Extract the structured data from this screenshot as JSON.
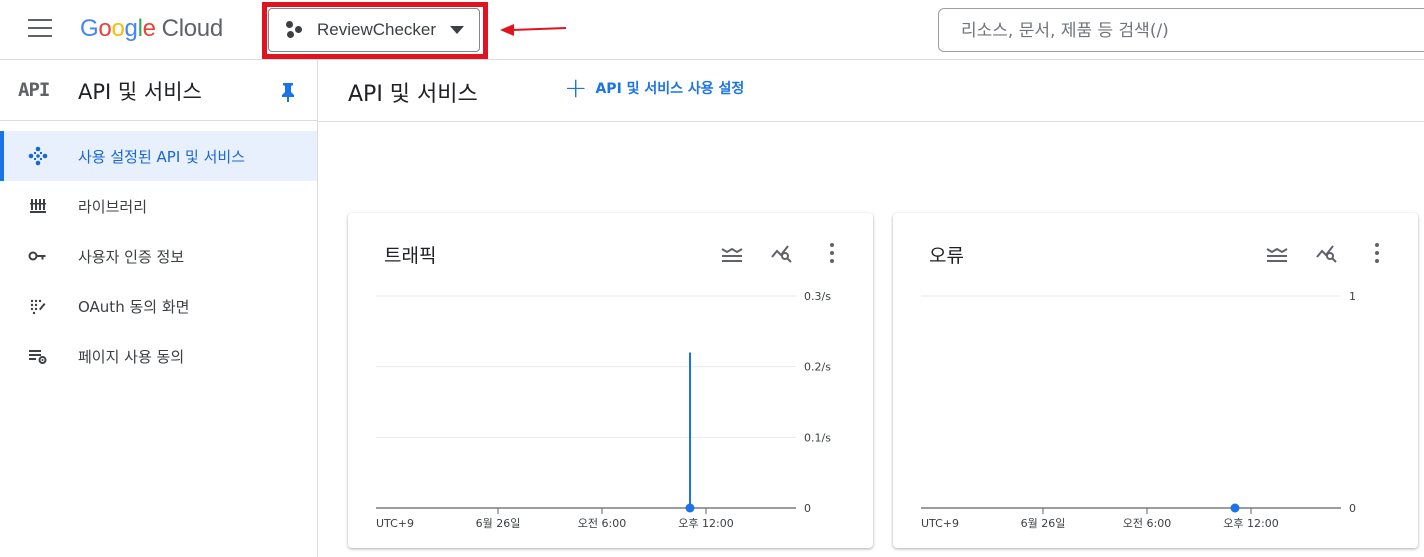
{
  "topbar": {
    "logo_parts": [
      "G",
      "o",
      "o",
      "g",
      "l",
      "e"
    ],
    "logo_cloud": "Cloud",
    "project_name": "ReviewChecker",
    "search_placeholder": "리소스, 문서, 제품 등 검색(/)",
    "highlight_color": "#e0141e"
  },
  "sidebar": {
    "icon_text": "API",
    "title": "API 및 서비스",
    "items": [
      {
        "label": "사용 설정된 API 및 서비스",
        "icon": "diamond-nodes-icon",
        "active": true
      },
      {
        "label": "라이브러리",
        "icon": "library-icon",
        "active": false
      },
      {
        "label": "사용자 인증 정보",
        "icon": "key-icon",
        "active": false
      },
      {
        "label": "OAuth 동의 화면",
        "icon": "oauth-icon",
        "active": false
      },
      {
        "label": "페이지 사용 동의",
        "icon": "settings-list-icon",
        "active": false
      }
    ]
  },
  "main": {
    "title": "API 및 서비스",
    "enable_label": "API 및 서비스 사용 설정"
  },
  "chart_data": [
    {
      "type": "line",
      "title": "트래픽",
      "y_ticks": [
        "0.3/s",
        "0.2/s",
        "0.1/s",
        "0"
      ],
      "ylim": [
        0,
        0.3
      ],
      "x_ticks": [
        "UTC+9",
        "6월 26일",
        "오전 6:00",
        "오후 12:00"
      ],
      "series": [
        {
          "values": [
            0,
            0.22,
            0
          ]
        }
      ],
      "grid": true,
      "color": "#1a73e8"
    },
    {
      "type": "line",
      "title": "오류",
      "y_ticks": [
        "1",
        "0"
      ],
      "ylim": [
        0,
        1
      ],
      "x_ticks": [
        "UTC+9",
        "6월 26일",
        "오전 6:00",
        "오후 12:00"
      ],
      "series": [
        {
          "values": [
            0
          ]
        }
      ],
      "grid": true,
      "color": "#1a73e8"
    }
  ]
}
